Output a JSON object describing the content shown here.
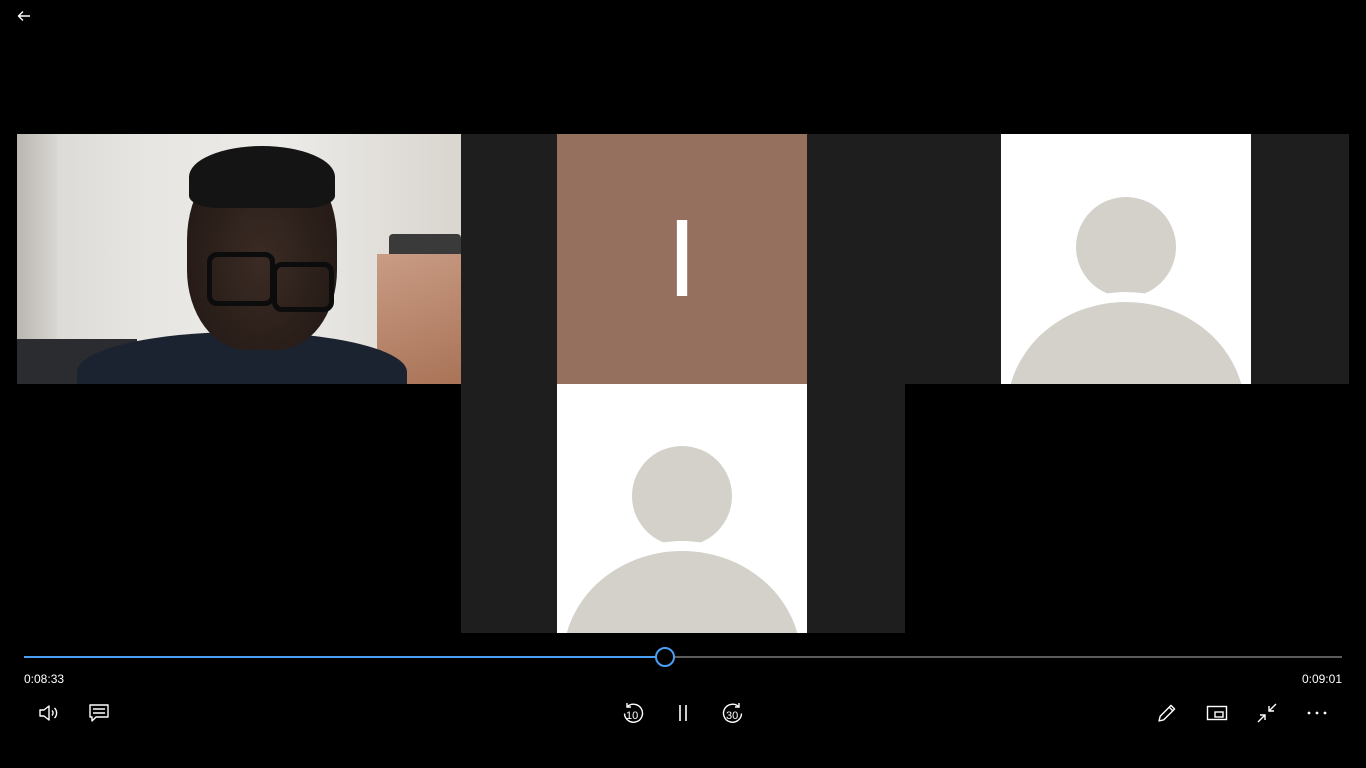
{
  "player": {
    "current_time": "0:08:33",
    "total_time": "0:09:01",
    "progress": 0.4867
  },
  "participants": {
    "initial_letter": "I"
  },
  "controls": {
    "skip_back_seconds": "10",
    "skip_forward_seconds": "30"
  },
  "icons": {
    "back": "arrow-left-icon",
    "volume": "volume-icon",
    "captions": "captions-icon",
    "skip_back": "skip-back-10-icon",
    "pause": "pause-icon",
    "skip_forward": "skip-forward-30-icon",
    "edit": "pencil-icon",
    "mini_view": "mini-view-icon",
    "exit_fullscreen": "exit-fullscreen-icon",
    "more": "more-icon"
  },
  "colors": {
    "accent": "#4a9ff5",
    "initial_tile_bg": "#95705f",
    "avatar_gray": "#d3d1ca",
    "panel_dark": "#1e1e1e"
  }
}
